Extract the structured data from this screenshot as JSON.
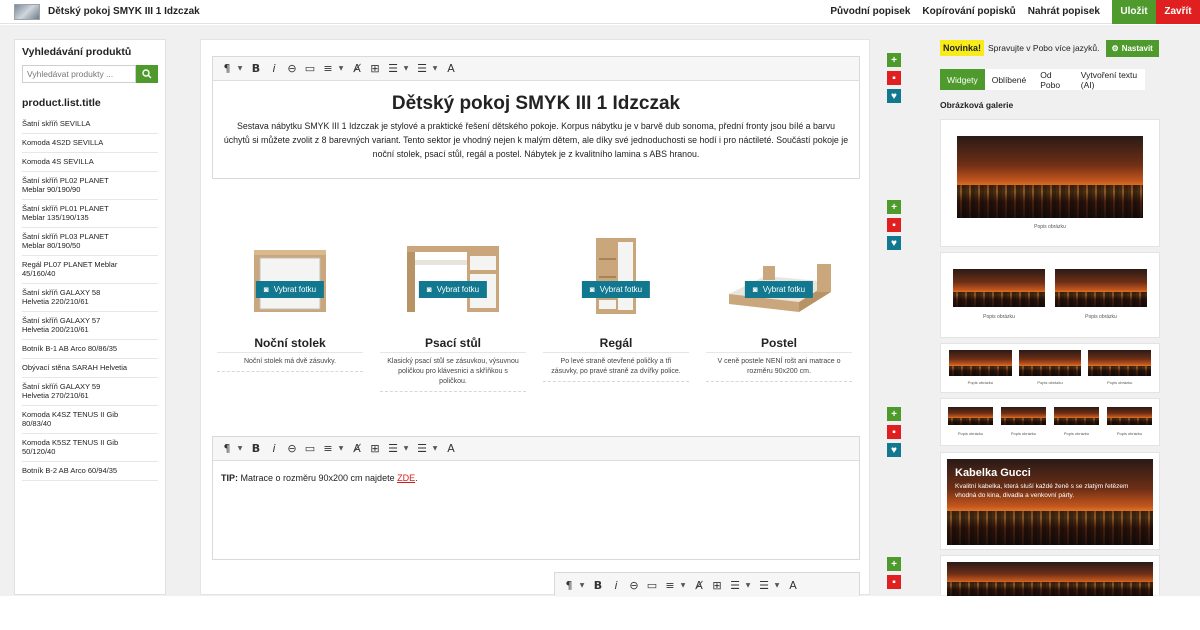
{
  "header": {
    "doc_title": "Dětský pokoj SMYK III 1 Idzczak",
    "links": [
      "Původní popisek",
      "Kopírování popisků",
      "Nahrát popisek"
    ],
    "save_label": "Uložit",
    "close_label": "Zavřít"
  },
  "sidebar": {
    "title": "Vyhledávání produktů",
    "search_placeholder": "Vyhledávat produkty ...",
    "list_title": "product.list.title",
    "items": [
      "Šatní skříň SEVILLA",
      "Komoda 4S2D SEVILLA",
      "Komoda 4S SEVILLA",
      "Šatní skříň PL02 PLANET\nMeblar 90/190/90",
      "Šatní skříň PL01 PLANET\nMeblar 135/190/135",
      "Šatní skříň PL03 PLANET\nMeblar 80/190/50",
      "Regál PL07 PLANET Meblar\n45/160/40",
      "Šatní skříň GALAXY 58\nHelvetia 220/210/61",
      "Šatní skříň GALAXY 57\nHelvetia 200/210/61",
      "Botník B-1 AB Arco 80/86/35",
      "Obývací stěna SARAH Helvetia",
      "Šatní skříň GALAXY 59\nHelvetia 270/210/61",
      "Komoda K4SZ TENUS II Gib\n80/83/40",
      "Komoda K5SZ TENUS II Gib\n50/120/40",
      "Botník B-2 AB Arco 60/94/35"
    ]
  },
  "editor": {
    "heading": "Dětský pokoj SMYK III 1 Idzczak",
    "intro": "Sestava nábytku SMYK III 1 Idzczak je stylové a praktické řešení dětského pokoje. Korpus nábytku je v barvě dub sonoma, přední fronty jsou bílé a barvu úchytů si můžete zvolit z 8 barevných variant. Tento sektor je vhodný nejen k malým dětem, ale díky své jednoduchosti se hodí i pro náctileté. Součástí pokoje je noční stolek, psací stůl, regál a postel. Nábytek je z kvalitního lamina s ABS hranou.",
    "pick_photo_label": "Vybrat fotku",
    "products": [
      {
        "name": "Noční stolek",
        "desc": "Noční stolek má dvě zásuvky."
      },
      {
        "name": "Psací stůl",
        "desc": "Klasický psací stůl se zásuvkou, výsuvnou poličkou pro klávesnici a skříňkou s poličkou."
      },
      {
        "name": "Regál",
        "desc": "Po levé straně otevřené poličky a tři zásuvky, po pravé straně za dvířky police."
      },
      {
        "name": "Postel",
        "desc": "V ceně postele NENÍ rošt ani matrace o rozměru 90x200 cm."
      }
    ],
    "tip_label": "TIP:",
    "tip_text": " Matrace o rozměru 90x200 cm najdete ",
    "tip_link": "ZDE",
    "tip_end": "."
  },
  "right_panel": {
    "news_badge": "Novinka!",
    "news_text": "Spravujte v Pobo více jazyků.",
    "settings_label": "Nastavit",
    "tabs": [
      "Widgety",
      "Oblíbené",
      "Od Pobo",
      "Vytvoření textu (AI)"
    ],
    "gallery_title": "Obrázková galerie",
    "caption": "Popis obrázku",
    "promo_title": "Kabelka Gucci",
    "promo_text": "Kvalitní kabelka, která sluší každé ženě s se zlatým řetězem vhodná do kina, divadla a venkovní párty."
  },
  "colors": {
    "green": "#4e9a2c",
    "red": "#e02020",
    "teal": "#12788f",
    "yellow": "#f7ec1a"
  }
}
